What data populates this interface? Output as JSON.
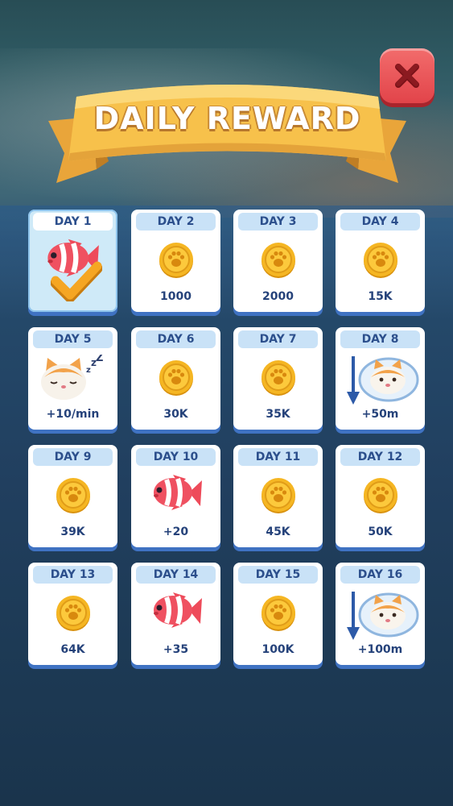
{
  "header": {
    "title": "DAILY REWARD"
  },
  "days": [
    {
      "label": "DAY 1",
      "reward": "",
      "icon": "fish-icon",
      "claimed": true
    },
    {
      "label": "DAY 2",
      "reward": "1000",
      "icon": "coin-icon",
      "claimed": false
    },
    {
      "label": "DAY 3",
      "reward": "2000",
      "icon": "coin-icon",
      "claimed": false
    },
    {
      "label": "DAY 4",
      "reward": "15K",
      "icon": "coin-icon",
      "claimed": false
    },
    {
      "label": "DAY 5",
      "reward": "+10/min",
      "icon": "sleeping-cat-icon",
      "claimed": false
    },
    {
      "label": "DAY 6",
      "reward": "30K",
      "icon": "coin-icon",
      "claimed": false
    },
    {
      "label": "DAY 7",
      "reward": "35K",
      "icon": "coin-icon",
      "claimed": false
    },
    {
      "label": "DAY 8",
      "reward": "+50m",
      "icon": "cat-depth-icon",
      "claimed": false
    },
    {
      "label": "DAY 9",
      "reward": "39K",
      "icon": "coin-icon",
      "claimed": false
    },
    {
      "label": "DAY 10",
      "reward": "+20",
      "icon": "fish-icon",
      "claimed": false
    },
    {
      "label": "DAY 11",
      "reward": "45K",
      "icon": "coin-icon",
      "claimed": false
    },
    {
      "label": "DAY 12",
      "reward": "50K",
      "icon": "coin-icon",
      "claimed": false
    },
    {
      "label": "DAY 13",
      "reward": "64K",
      "icon": "coin-icon",
      "claimed": false
    },
    {
      "label": "DAY 14",
      "reward": "+35",
      "icon": "fish-icon",
      "claimed": false
    },
    {
      "label": "DAY 15",
      "reward": "100K",
      "icon": "coin-icon",
      "claimed": false
    },
    {
      "label": "DAY 16",
      "reward": "+100m",
      "icon": "cat-depth-icon",
      "claimed": false
    }
  ],
  "colors": {
    "card_bg": "#ffffff",
    "claimed_bg": "#cfeaf8",
    "card_border": "#3f72c2",
    "day_pill": "#c9e2f7",
    "day_text": "#2c4f8c",
    "banner": "#f7c14b",
    "close_button": "#e2444a",
    "checkmark": "#f5a623"
  }
}
